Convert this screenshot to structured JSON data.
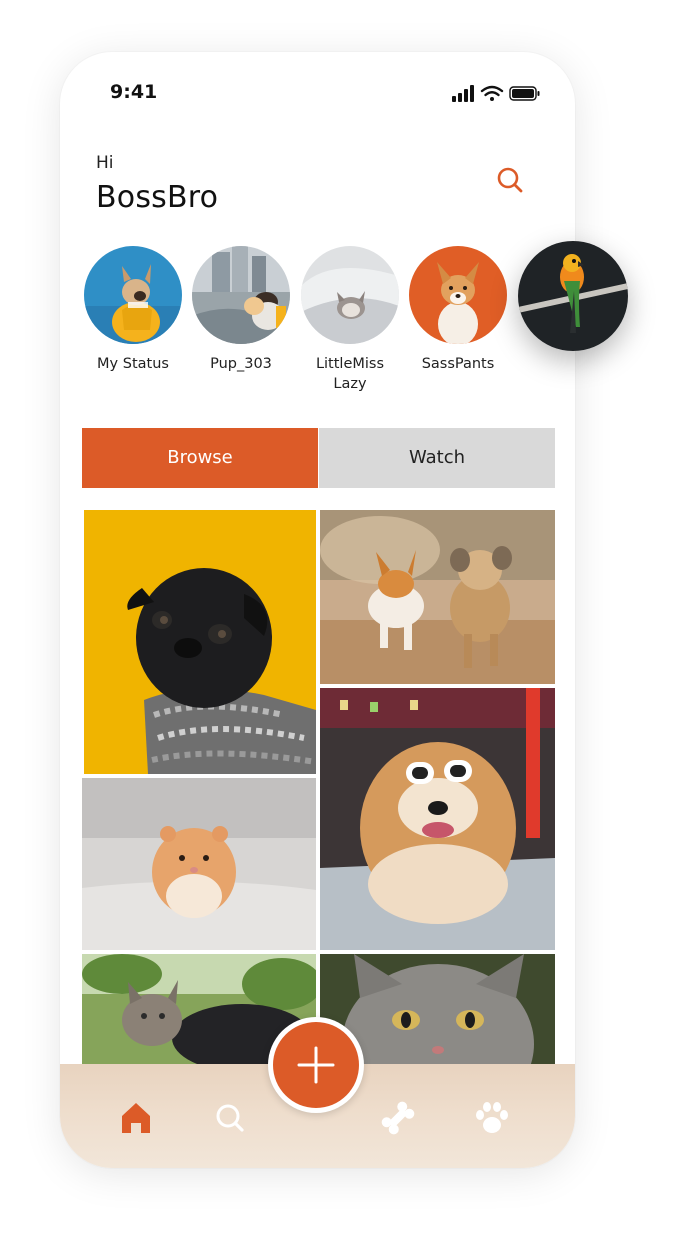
{
  "status_bar": {
    "time": "9:41"
  },
  "header": {
    "greeting": "Hi",
    "username": "BossBro"
  },
  "stories": [
    {
      "label": "My Status"
    },
    {
      "label": "Pup_303"
    },
    {
      "label": "LittleMiss Lazy"
    },
    {
      "label": "SassPants"
    }
  ],
  "tabs": {
    "browse": "Browse",
    "watch": "Watch",
    "active": "Browse"
  },
  "feed": [
    {
      "subject": "black pug in scarf on yellow"
    },
    {
      "subject": "corgi and terrier running"
    },
    {
      "subject": "fluffy dog with sunglasses"
    },
    {
      "subject": "hamster"
    },
    {
      "subject": "cat lying on grass"
    },
    {
      "subject": "gray cat close-up"
    }
  ],
  "bottom_nav": {
    "items": [
      "home-icon",
      "search-icon",
      "bone-icon",
      "paw-icon"
    ],
    "active": "home-icon",
    "fab_icon": "plus-icon"
  },
  "colors": {
    "accent": "#dc5b28",
    "tab_inactive": "#d9d9d9",
    "nav_bg": "#eddccb"
  }
}
